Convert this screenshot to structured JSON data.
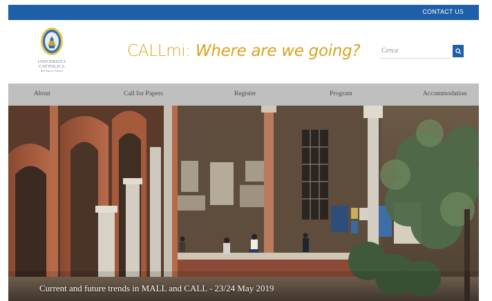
{
  "topbar": {
    "contact_label": "CONTACT US"
  },
  "header": {
    "logo": {
      "line1": "UNIVERSITÀ",
      "line2": "CATTOLICA",
      "line3": "del Sacro Cuore"
    },
    "title_plain": "CALLmi: ",
    "title_italic": "Where are we going?",
    "search": {
      "placeholder": "Cerca",
      "icon": "search-icon"
    }
  },
  "nav": {
    "items": [
      {
        "label": "About"
      },
      {
        "label": "Call for Papers"
      },
      {
        "label": "Register"
      },
      {
        "label": "Program"
      },
      {
        "label": "Accommodation"
      }
    ]
  },
  "hero": {
    "caption": "Current and future trends in MALL and CALL - 23/24 May 2019"
  },
  "colors": {
    "brand_blue": "#1d5fa8",
    "title_gold": "#d9a21e",
    "nav_gray": "#bfbfbf"
  }
}
